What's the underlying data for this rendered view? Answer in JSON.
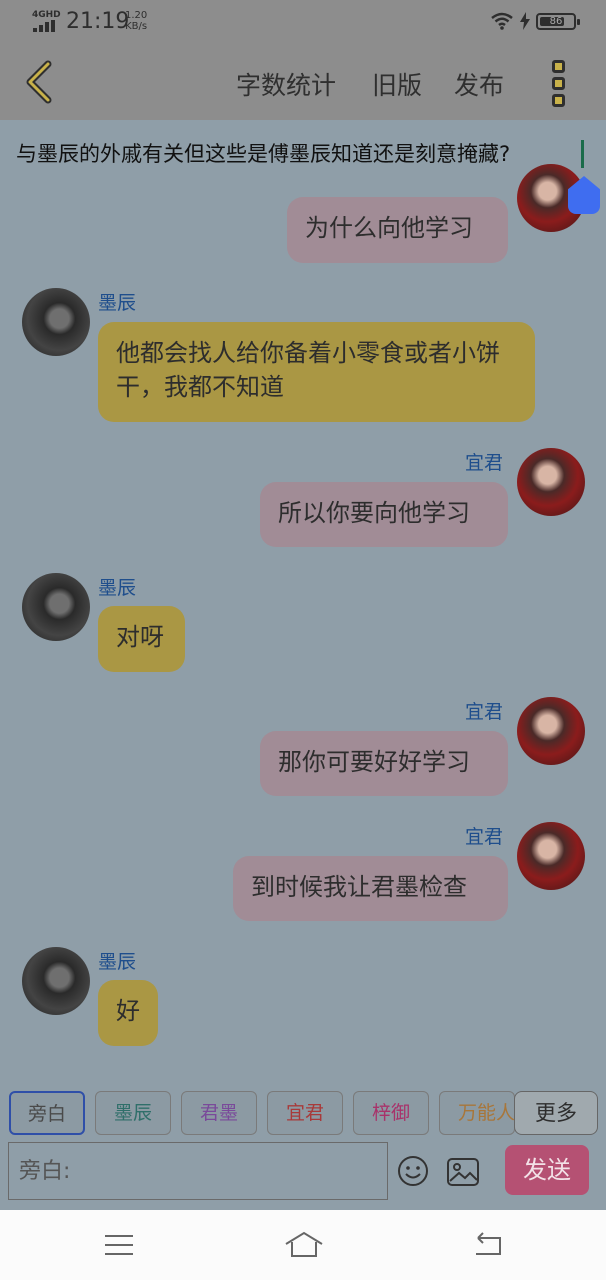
{
  "status_bar": {
    "network": "4GHD",
    "time": "21:19",
    "speed_value": "1.20",
    "speed_unit": "KB/s",
    "battery": "86"
  },
  "top_bar": {
    "items": [
      {
        "label": "字数统计"
      },
      {
        "label": "旧版"
      },
      {
        "label": "发布"
      }
    ]
  },
  "title": "与墨辰的外戚有关但这些是傅墨辰知道还是刻意掩藏?",
  "messages": [
    {
      "name": "",
      "text": "为什么向他学习"
    },
    {
      "name": "墨辰",
      "text": "他都会找人给你备着小零食或者小饼干，我都不知道"
    },
    {
      "name": "宜君",
      "text": "所以你要向他学习"
    },
    {
      "name": "墨辰",
      "text": "对呀"
    },
    {
      "name": "宜君",
      "text": "那你可要好好学习"
    },
    {
      "name": "宜君",
      "text": "到时候我让君墨检查"
    },
    {
      "name": "墨辰",
      "text": "好"
    }
  ],
  "characters": [
    {
      "label": "旁白",
      "color": "#4a4a4a"
    },
    {
      "label": "墨辰",
      "color": "#2f6f6a"
    },
    {
      "label": "君墨",
      "color": "#7a4a9a"
    },
    {
      "label": "宜君",
      "color": "#a83a3a"
    },
    {
      "label": "梓御",
      "color": "#a8326a"
    },
    {
      "label": "万能人",
      "color": "#a8763a"
    }
  ],
  "more_label": "更多",
  "input": {
    "placeholder": "旁白:"
  },
  "send_label": "发送",
  "colors": {
    "narrator_bubble": "#aa9744",
    "user_bubble": "#a18c96",
    "name": "#1f4e8c",
    "send": "#b55173",
    "handle": "#3f6df0"
  },
  "icons": [
    "back-arrow-icon",
    "menu-icon",
    "emoji-icon",
    "image-icon",
    "nav-menu-icon",
    "nav-home-icon",
    "nav-back-icon"
  ]
}
